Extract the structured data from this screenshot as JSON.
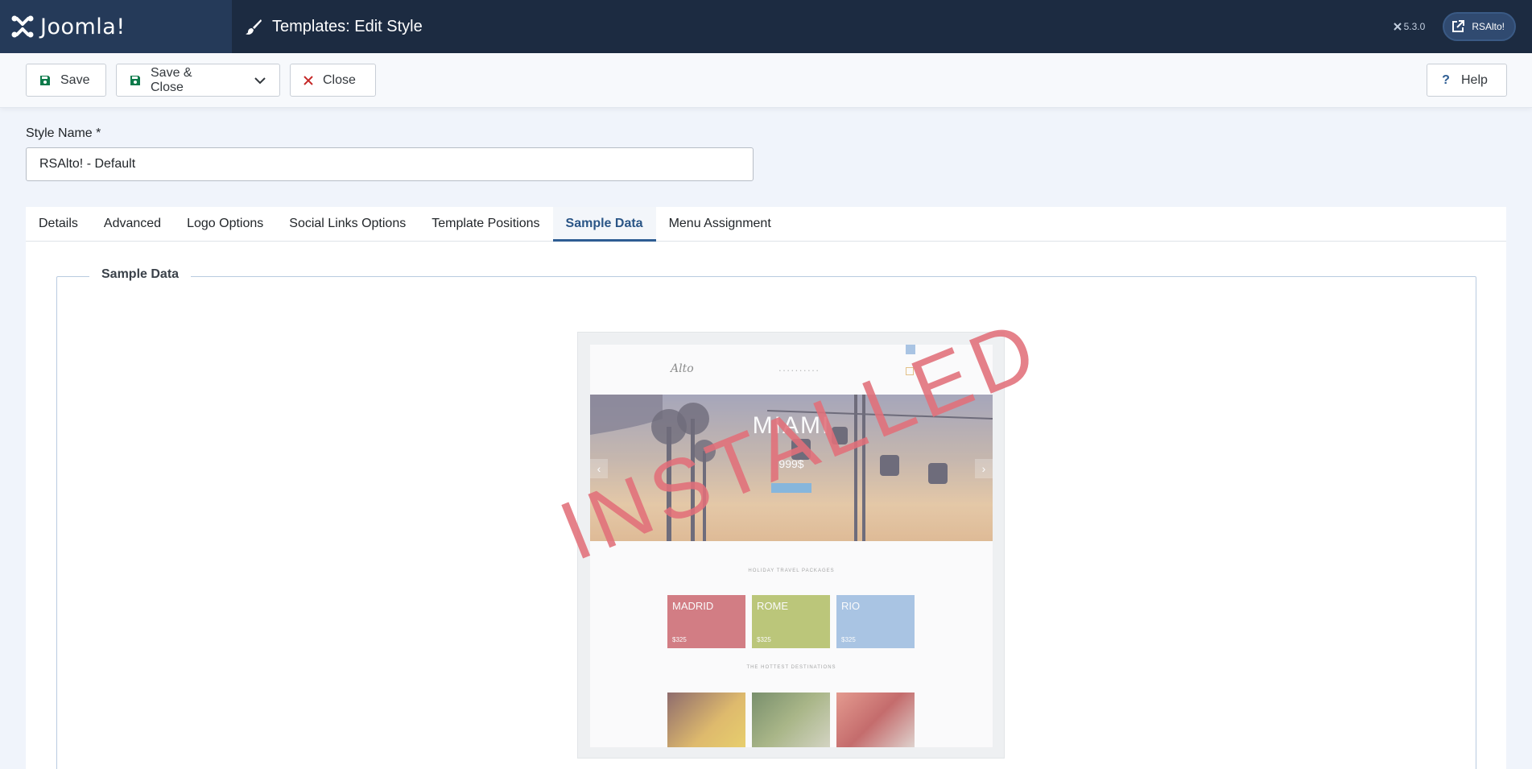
{
  "header": {
    "brand": "Joomla!",
    "page_title": "Templates: Edit Style",
    "version": "5.3.0",
    "site_label": "RSAlto!"
  },
  "toolbar": {
    "save_label": "Save",
    "save_close_label": "Save & Close",
    "close_label": "Close",
    "help_label": "Help"
  },
  "form": {
    "style_name_label": "Style Name *",
    "style_name_value": "RSAlto! - Default"
  },
  "tabs": [
    {
      "label": "Details"
    },
    {
      "label": "Advanced"
    },
    {
      "label": "Logo Options"
    },
    {
      "label": "Social Links Options"
    },
    {
      "label": "Template Positions"
    },
    {
      "label": "Sample Data",
      "active": true
    },
    {
      "label": "Menu Assignment"
    }
  ],
  "sample_data": {
    "legend": "Sample Data",
    "stamp_text": "INSTALLED",
    "preview": {
      "logo": "Alto",
      "hero_title": "MIAMI",
      "hero_price": "999$",
      "section1_title": "HOLIDAY TRAVEL PACKAGES",
      "cards": [
        {
          "city": "MADRID",
          "price": "$325",
          "color": "#c8525a"
        },
        {
          "city": "ROME",
          "price": "$325",
          "color": "#a8b64c"
        },
        {
          "city": "RIO",
          "price": "$325",
          "color": "#8fb4de"
        }
      ],
      "section2_title": "THE HOTTEST DESTINATIONS"
    }
  },
  "colors": {
    "header_bg": "#1c2b41",
    "logo_bg": "#253a59",
    "accent": "#2e5d93",
    "close_icon": "#c52827",
    "stamp": "#e2707a"
  }
}
